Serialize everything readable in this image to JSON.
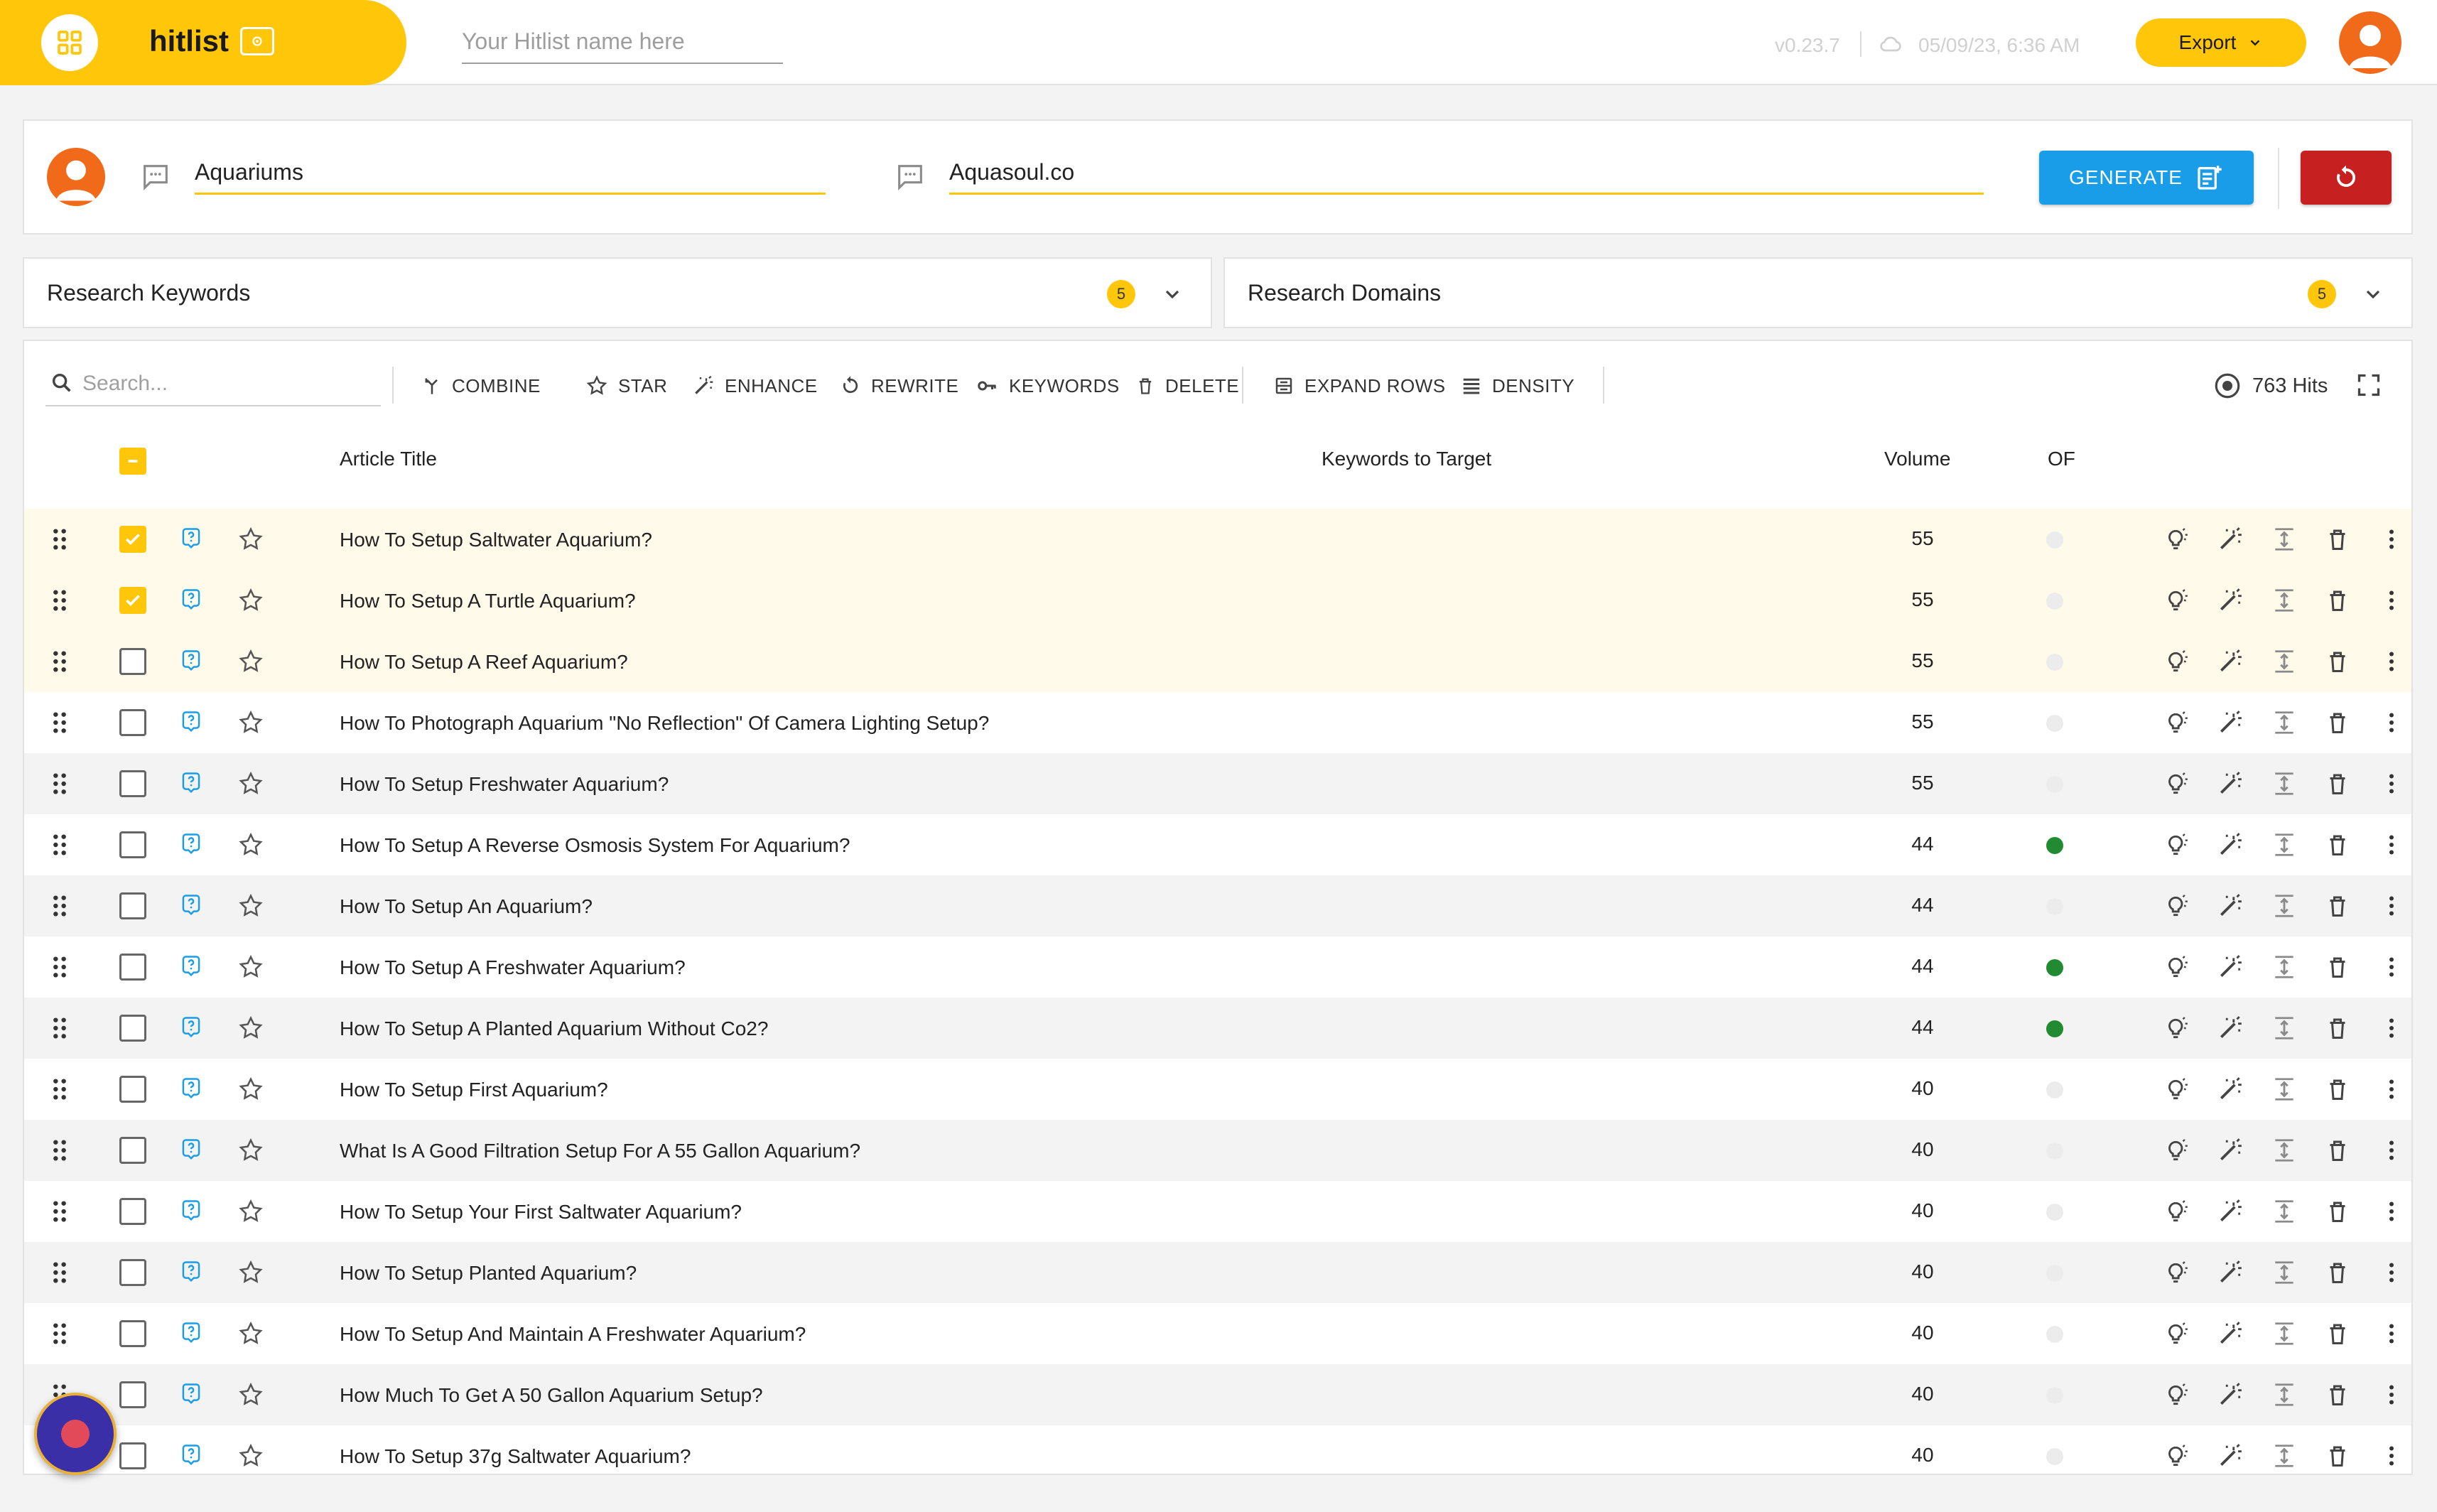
{
  "app": {
    "name": "hitlist",
    "hitlist_name_placeholder": "Your Hitlist name here",
    "version": "v0.23.7",
    "saved_time": "05/09/23, 6:36 AM",
    "export_label": "Export"
  },
  "generator": {
    "topic_value": "Aquariums",
    "domain_value": "Aquasoul.co",
    "generate_label": "GENERATE"
  },
  "research": {
    "keywords": {
      "title": "Research Keywords",
      "count": "5"
    },
    "domains": {
      "title": "Research Domains",
      "count": "5"
    }
  },
  "toolbar": {
    "search_placeholder": "Search...",
    "combine": "COMBINE",
    "star": "STAR",
    "enhance": "ENHANCE",
    "rewrite": "REWRITE",
    "keywords": "KEYWORDS",
    "delete": "DELETE",
    "expand_rows": "EXPAND ROWS",
    "density": "DENSITY",
    "hits": "763 Hits"
  },
  "table": {
    "headers": {
      "title": "Article Title",
      "keywords": "Keywords to Target",
      "volume": "Volume",
      "of": "OF"
    },
    "rows": [
      {
        "title": "How To Setup Saltwater Aquarium?",
        "volume": "55",
        "checked": true,
        "of": false
      },
      {
        "title": "How To Setup A Turtle Aquarium?",
        "volume": "55",
        "checked": true,
        "of": false
      },
      {
        "title": "How To Setup A Reef Aquarium?",
        "volume": "55",
        "checked": false,
        "of": false
      },
      {
        "title": "How To Photograph Aquarium \"No Reflection\" Of Camera Lighting Setup?",
        "volume": "55",
        "checked": false,
        "of": false
      },
      {
        "title": "How To Setup Freshwater Aquarium?",
        "volume": "55",
        "checked": false,
        "of": false
      },
      {
        "title": "How To Setup A Reverse Osmosis System For Aquarium?",
        "volume": "44",
        "checked": false,
        "of": true
      },
      {
        "title": "How To Setup An Aquarium?",
        "volume": "44",
        "checked": false,
        "of": false
      },
      {
        "title": "How To Setup A Freshwater Aquarium?",
        "volume": "44",
        "checked": false,
        "of": true
      },
      {
        "title": "How To Setup A Planted Aquarium Without Co2?",
        "volume": "44",
        "checked": false,
        "of": true
      },
      {
        "title": "How To Setup First Aquarium?",
        "volume": "40",
        "checked": false,
        "of": false
      },
      {
        "title": "What Is A Good Filtration Setup For A 55 Gallon Aquarium?",
        "volume": "40",
        "checked": false,
        "of": false
      },
      {
        "title": "How To Setup Your First Saltwater Aquarium?",
        "volume": "40",
        "checked": false,
        "of": false
      },
      {
        "title": "How To Setup Planted Aquarium?",
        "volume": "40",
        "checked": false,
        "of": false
      },
      {
        "title": "How To Setup And Maintain A Freshwater Aquarium?",
        "volume": "40",
        "checked": false,
        "of": false
      },
      {
        "title": "How Much To Get A 50 Gallon Aquarium Setup?",
        "volume": "40",
        "checked": false,
        "of": false
      },
      {
        "title": "How To Setup 37g Saltwater Aquarium?",
        "volume": "40",
        "checked": false,
        "of": false
      }
    ]
  },
  "icons": {
    "logo": "grid-icon",
    "badge": "camera-icon",
    "row_actions": [
      "lightbulb-icon",
      "magic-wand-icon",
      "expand-row-icon",
      "trash-icon",
      "more-vert-icon"
    ]
  },
  "colors": {
    "brand": "#ffc60a",
    "generate": "#1a9de8",
    "reset": "#c62020",
    "of_on": "#228b32",
    "avatar": "#f06a1a"
  }
}
